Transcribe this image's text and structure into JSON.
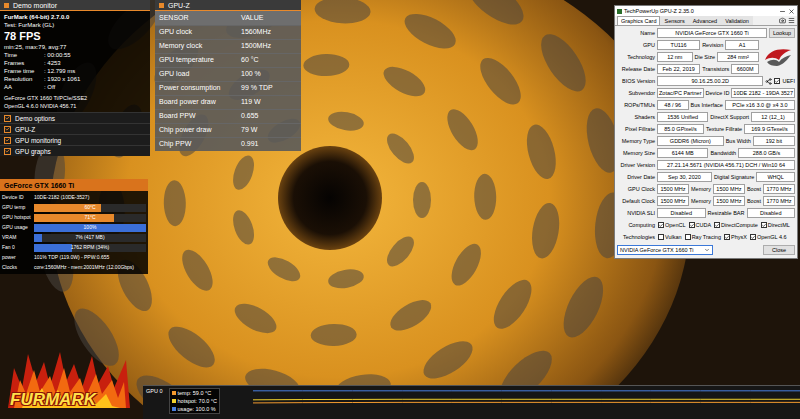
{
  "demo_monitor": {
    "title": "Demo monitor",
    "app": "FurMark (64-bit) 2.7.0.0",
    "test": "Test: FurMark (GL)",
    "fps": "78 FPS",
    "fps_stats": "min:25, max:79, avg:77",
    "stats": [
      {
        "label": "Time",
        "value": ": 00:00:55"
      },
      {
        "label": "Frames",
        "value": ": 4253"
      },
      {
        "label": "Frame time",
        "value": ": 12.799 ms"
      },
      {
        "label": "Resolution",
        "value": ": 1920 x 1061"
      },
      {
        "label": "AA",
        "value": ": Off"
      }
    ],
    "renderer": "GeForce GTX 1660 Ti/PCIe/SSE2",
    "opengl": "OpenGL 4.6.0 NVIDIA 456.71",
    "options": [
      {
        "label": "Demo options",
        "checked": true
      },
      {
        "label": "GPU-Z",
        "checked": true
      },
      {
        "label": "GPU monitoring",
        "checked": true
      },
      {
        "label": "GPU graphs",
        "checked": true
      }
    ]
  },
  "gpuz_overlay": {
    "title": "GPU-Z",
    "columns": [
      "SENSOR",
      "VALUE"
    ],
    "rows": [
      {
        "sensor": "GPU clock",
        "value": "1560MHz"
      },
      {
        "sensor": "Memory clock",
        "value": "1500MHz"
      },
      {
        "sensor": "GPU temperature",
        "value": "60 °C"
      },
      {
        "sensor": "GPU load",
        "value": "100 %"
      },
      {
        "sensor": "Power consumption",
        "value": "99 % TDP"
      },
      {
        "sensor": "Board power draw",
        "value": "119 W"
      },
      {
        "sensor": "Board PPW",
        "value": "0.655"
      },
      {
        "sensor": "Chip power draw",
        "value": "79 W"
      },
      {
        "sensor": "Chip PPW",
        "value": "0.991"
      }
    ]
  },
  "gpu_panel": {
    "title": "GeForce GTX 1660 Ti",
    "rows": [
      {
        "label": "Device ID",
        "value": "10DE-2182 (10DE-3527)",
        "kind": "text"
      },
      {
        "label": "GPU temp",
        "value": "60°C",
        "kind": "bar",
        "level": 0.6,
        "color": "#e8892b"
      },
      {
        "label": "GPU hotspot",
        "value": "71°C",
        "kind": "bar",
        "level": 0.71,
        "color": "#e8892b"
      },
      {
        "label": "GPU usage",
        "value": "100%",
        "kind": "bar",
        "level": 1.0,
        "color": "#3b6fd8"
      },
      {
        "label": "VRAM",
        "value": "7% (417 MB)",
        "kind": "bar",
        "level": 0.07,
        "color": "#3b6fd8"
      },
      {
        "label": "Fan 0",
        "value": "1762 RPM (34%)",
        "kind": "bar",
        "level": 0.34,
        "color": "#3b6fd8"
      },
      {
        "label": "power",
        "value": "101% TDP (119.0W) - PPW:0.655",
        "kind": "text"
      },
      {
        "label": "Clocks",
        "value": "core:1560MHz - mem:2001MHz (12.00Gbps)",
        "kind": "text"
      }
    ]
  },
  "logo": {
    "text": "FURMARK"
  },
  "graph": {
    "title": "GPU 0",
    "legend": [
      {
        "label": "temp: 59.0 °C",
        "color": "#f29a2e",
        "values": [
          57,
          58,
          58.5,
          59,
          59,
          59,
          59,
          59,
          59,
          59,
          59,
          59
        ]
      },
      {
        "label": "hotspot: 70.0 °C",
        "color": "#f2d22e",
        "values": [
          68,
          69,
          69.5,
          70,
          70,
          70,
          70,
          70,
          70,
          70,
          70,
          70
        ]
      },
      {
        "label": "usage: 100.0 %",
        "color": "#4a7fe0",
        "values": [
          100,
          100,
          100,
          100,
          100,
          100,
          100,
          100,
          100,
          100,
          100,
          100
        ]
      }
    ]
  },
  "gpuz_window": {
    "title": "TechPowerUp GPU-Z 2.35.0",
    "tabs": [
      {
        "label": "Graphics Card",
        "selected": true
      },
      {
        "label": "Sensors",
        "selected": false
      },
      {
        "label": "Advanced",
        "selected": false
      },
      {
        "label": "Validation",
        "selected": false
      }
    ],
    "name_row": {
      "label": "Name",
      "value": "NVIDIA GeForce GTX 1660 Ti",
      "button": "Lookup"
    },
    "top_rows": [
      [
        {
          "label": "GPU",
          "value": "TU116"
        },
        {
          "label": "Revision",
          "value": "A1"
        }
      ],
      [
        {
          "label": "Technology",
          "value": "12 nm"
        },
        {
          "label": "Die Size",
          "value": "284 mm²"
        }
      ],
      [
        {
          "label": "Release Date",
          "value": "Feb 22, 2019"
        },
        {
          "label": "Transistors",
          "value": "6600M"
        }
      ]
    ],
    "bios_row": {
      "label": "BIOS Version",
      "value": "90.16.25.00.2D",
      "uefi": {
        "label": "UEFI",
        "checked": true
      }
    },
    "rows": [
      [
        {
          "label": "Subvendor",
          "value": "Zotac/PC Partner"
        },
        {
          "label": "Device ID",
          "value": "10DE 2182 - 19DA 3527"
        }
      ],
      [
        {
          "label": "ROPs/TMUs",
          "value": "48 / 96"
        },
        {
          "label": "Bus Interface",
          "value": "PCIe x16 3.0 @ x4 3.0"
        }
      ],
      [
        {
          "label": "Shaders",
          "value": "1536 Unified"
        },
        {
          "label": "DirectX Support",
          "value": "12 (12_1)"
        }
      ],
      [
        {
          "label": "Pixel Fillrate",
          "value": "85.0 GPixel/s"
        },
        {
          "label": "Texture Fillrate",
          "value": "169.9 GTexel/s"
        }
      ],
      [
        {
          "label": "Memory Type",
          "value": "GDDR6 (Micron)"
        },
        {
          "label": "Bus Width",
          "value": "192 bit"
        }
      ],
      [
        {
          "label": "Memory Size",
          "value": "6144 MB"
        },
        {
          "label": "Bandwidth",
          "value": "288.0 GB/s"
        }
      ],
      [
        {
          "label": "Driver Version",
          "value": "27.21.14.5671 (NVIDIA 456.71) DCH / Win10 64"
        }
      ],
      [
        {
          "label": "Driver Date",
          "value": "Sep 30, 2020"
        },
        {
          "label": "Digital Signature",
          "value": "WHQL"
        }
      ],
      [
        {
          "label": "GPU Clock",
          "value": "1500 MHz"
        },
        {
          "label": "Memory",
          "value": "1500 MHz"
        },
        {
          "label": "Boost",
          "value": "1770 MHz"
        }
      ],
      [
        {
          "label": "Default Clock",
          "value": "1500 MHz"
        },
        {
          "label": "Memory",
          "value": "1500 MHz"
        },
        {
          "label": "Boost",
          "value": "1770 MHz"
        }
      ],
      [
        {
          "label": "NVIDIA SLI",
          "value": "Disabled"
        },
        {
          "label": "Resizable BAR",
          "value": "Disabled"
        }
      ]
    ],
    "features": [
      {
        "label": "Computing",
        "items": [
          {
            "label": "OpenCL",
            "checked": true
          },
          {
            "label": "CUDA",
            "checked": true
          },
          {
            "label": "DirectCompute",
            "checked": true
          },
          {
            "label": "DirectML",
            "checked": true
          }
        ]
      },
      {
        "label": "Technologies",
        "items": [
          {
            "label": "Vulkan",
            "checked": false
          },
          {
            "label": "Ray Tracing",
            "checked": false
          },
          {
            "label": "PhysX",
            "checked": true
          },
          {
            "label": "OpenGL 4.6",
            "checked": true
          }
        ]
      }
    ],
    "device_select": "NVIDIA GeForce GTX 1660 Ti",
    "close": "Close"
  }
}
